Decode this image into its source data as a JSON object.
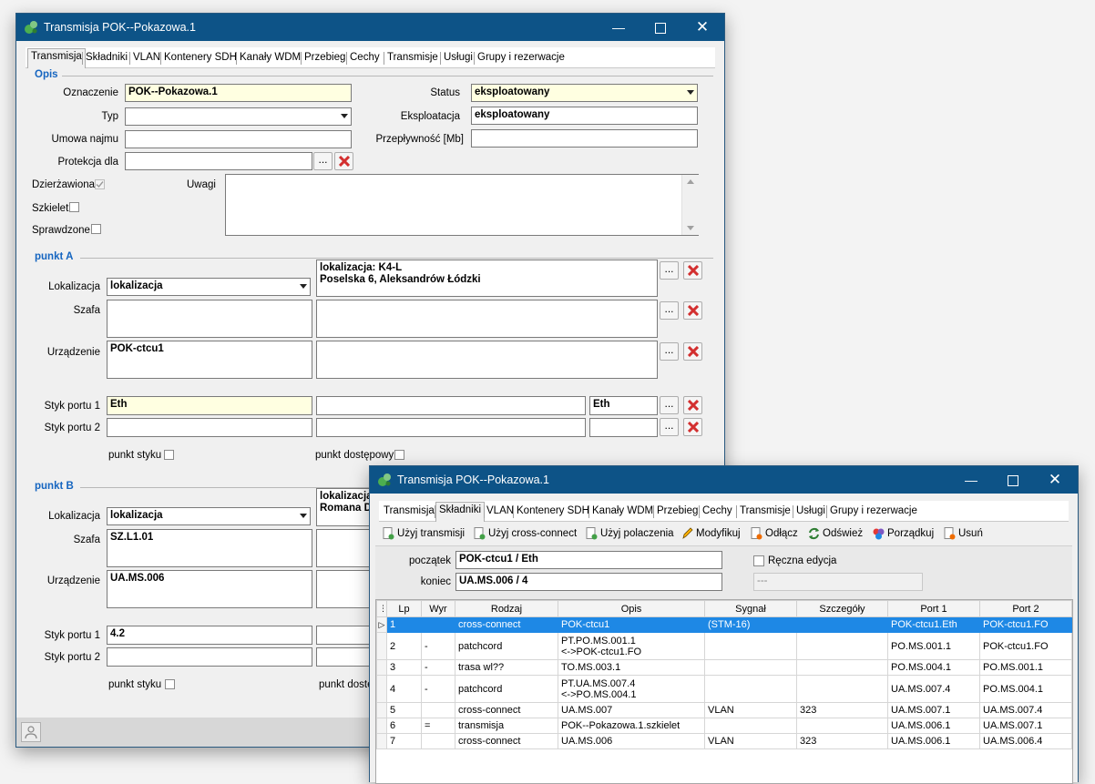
{
  "main_window": {
    "title": "Transmisja POK--Pokazowa.1",
    "tabs": [
      "Transmisja",
      "Składniki",
      "VLAN",
      "Kontenery SDH",
      "Kanały WDM",
      "Przebieg",
      "Cechy",
      "Transmisje",
      "Usługi",
      "Grupy i rezerwacje"
    ],
    "opis": {
      "group_label": "Opis",
      "oznaczenie_label": "Oznaczenie",
      "oznaczenie_value": "POK--Pokazowa.1",
      "typ_label": "Typ",
      "typ_value": "",
      "umowa_label": "Umowa najmu",
      "umowa_value": "",
      "protekcja_label": "Protekcja dla",
      "protekcja_value": "",
      "status_label": "Status",
      "status_value": "eksploatowany",
      "eksploatacja_label": "Eksploatacja",
      "eksploatacja_value": "eksploatowany",
      "przeplywnosc_label": "Przepływność [Mb]",
      "przeplywnosc_value": "",
      "dzierzawiona_label": "Dzierżawiona",
      "szkielet_label": "Szkielet",
      "sprawdzone_label": "Sprawdzone",
      "uwagi_label": "Uwagi",
      "uwagi_value": ""
    },
    "punkt_a": {
      "group_label": "punkt A",
      "lokalizacja_label": "Lokalizacja",
      "lokalizacja_value": "lokalizacja",
      "lokalizacja_desc": "lokalizacja: K4-L\nPoselska 6, Aleksandrów Łódzki",
      "szafa_label": "Szafa",
      "szafa_value": "",
      "szafa_desc": "",
      "urzadzenie_label": "Urządzenie",
      "urzadzenie_value": "POK-ctcu1",
      "urzadzenie_desc": "",
      "styk1_label": "Styk portu 1",
      "styk1_value": "Eth",
      "styk1_mid": "",
      "styk1_right": "Eth",
      "styk2_label": "Styk portu 2",
      "styk2_value": "",
      "styk2_mid": "",
      "styk2_right": "",
      "punkt_styku_label": "punkt styku",
      "punkt_dostepowy_label": "punkt dostępowy"
    },
    "punkt_b": {
      "group_label": "punkt B",
      "lokalizacja_label": "Lokalizacja",
      "lokalizacja_value": "lokalizacja",
      "lokalizacja_desc": "lokalizacja\nRomana D",
      "szafa_label": "Szafa",
      "szafa_value": "SZ.L1.01",
      "urzadzenie_label": "Urządzenie",
      "urzadzenie_value": "UA.MS.006",
      "styk1_label": "Styk portu 1",
      "styk1_value": "4.2",
      "styk2_label": "Styk portu 2",
      "styk2_value": "",
      "punkt_styku_label": "punkt styku",
      "punkt_dostepowy_label": "punkt doste"
    }
  },
  "sub_window": {
    "title": "Transmisja POK--Pokazowa.1",
    "tabs": [
      "Transmisja",
      "Składniki",
      "VLAN",
      "Kontenery SDH",
      "Kanały WDM",
      "Przebieg",
      "Cechy",
      "Transmisje",
      "Usługi",
      "Grupy i rezerwacje"
    ],
    "toolbar": [
      "Użyj transmisji",
      "Użyj cross-connect",
      "Użyj polaczenia",
      "Modyfikuj",
      "Odłącz",
      "Odśwież",
      "Porządkuj",
      "Usuń"
    ],
    "poczatek_label": "początek",
    "poczatek_value": "POK-ctcu1 / Eth",
    "koniec_label": "koniec",
    "koniec_value": "UA.MS.006 / 4",
    "reczna_label": "Ręczna edycja",
    "reczna_value": "---",
    "columns": [
      "Lp",
      "Wyr",
      "Rodzaj",
      "Opis",
      "Sygnał",
      "Szczegóły",
      "Port 1",
      "Port 2"
    ],
    "rows": [
      {
        "lp": "1",
        "wyr": "",
        "rodzaj": "cross-connect",
        "opis": "POK-ctcu1",
        "sygnal": "(STM-16)",
        "szczegoly": "",
        "port1": "POK-ctcu1.Eth",
        "port2": "POK-ctcu1.FO"
      },
      {
        "lp": "2",
        "wyr": "-",
        "rodzaj": "patchcord",
        "opis": "PT.PO.MS.001.1\n<->POK-ctcu1.FO",
        "sygnal": "",
        "szczegoly": "",
        "port1": "PO.MS.001.1",
        "port2": "POK-ctcu1.FO"
      },
      {
        "lp": "3",
        "wyr": "-",
        "rodzaj": "trasa wl??",
        "opis": "TO.MS.003.1",
        "sygnal": "",
        "szczegoly": "",
        "port1": "PO.MS.004.1",
        "port2": "PO.MS.001.1"
      },
      {
        "lp": "4",
        "wyr": "-",
        "rodzaj": "patchcord",
        "opis": "PT.UA.MS.007.4\n<->PO.MS.004.1",
        "sygnal": "",
        "szczegoly": "",
        "port1": "UA.MS.007.4",
        "port2": "PO.MS.004.1"
      },
      {
        "lp": "5",
        "wyr": "",
        "rodzaj": "cross-connect",
        "opis": "UA.MS.007",
        "sygnal": "VLAN",
        "szczegoly": "323",
        "port1": "UA.MS.007.1",
        "port2": "UA.MS.007.4"
      },
      {
        "lp": "6",
        "wyr": "=",
        "rodzaj": "transmisja",
        "opis": "POK--Pokazowa.1.szkielet",
        "sygnal": "",
        "szczegoly": "",
        "port1": "UA.MS.006.1",
        "port2": "UA.MS.007.1"
      },
      {
        "lp": "7",
        "wyr": "",
        "rodzaj": "cross-connect",
        "opis": "UA.MS.006",
        "sygnal": "VLAN",
        "szczegoly": "323",
        "port1": "UA.MS.006.1",
        "port2": "UA.MS.006.4"
      }
    ]
  }
}
